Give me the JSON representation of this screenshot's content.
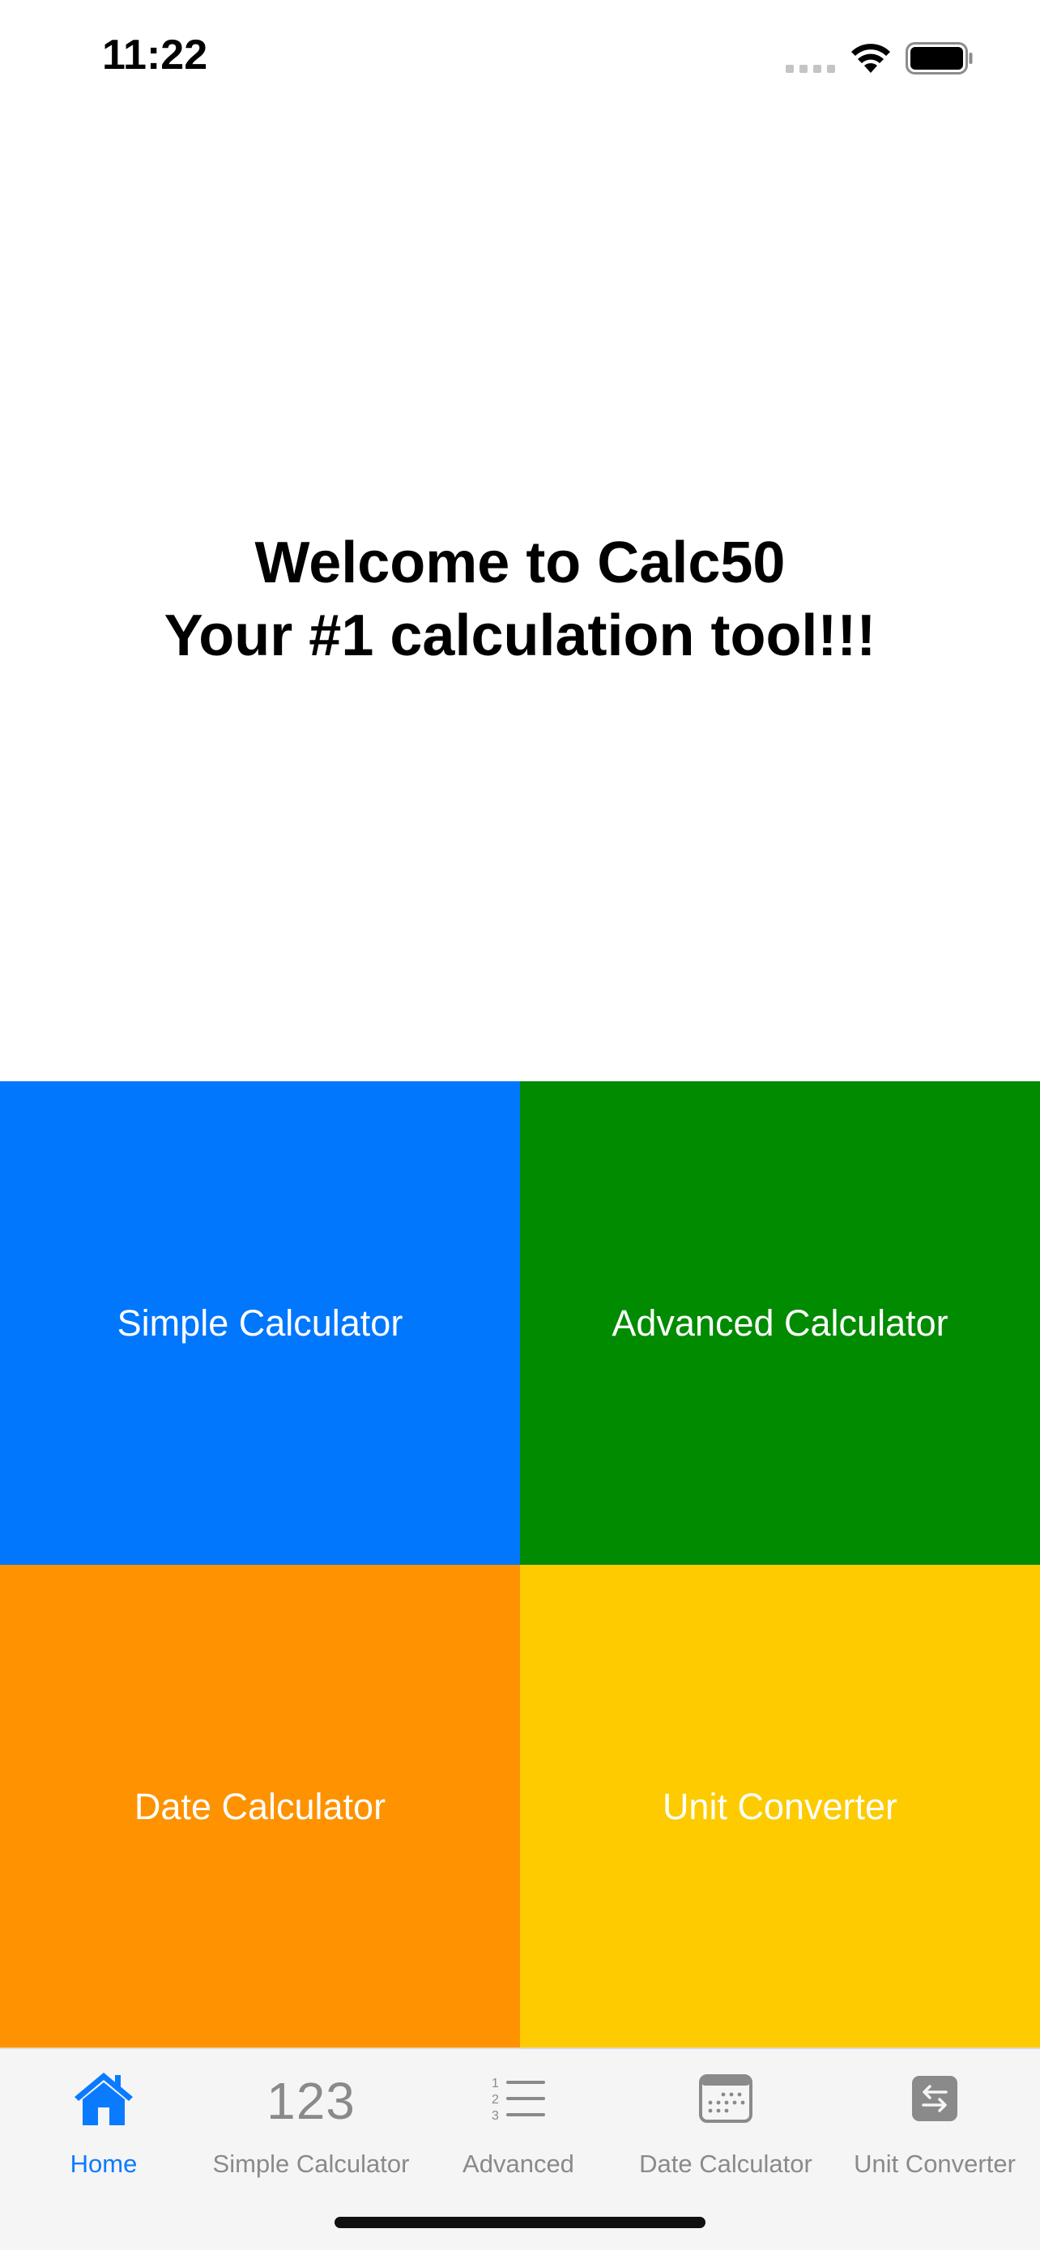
{
  "status_bar": {
    "time": "11:22"
  },
  "welcome": {
    "line1": "Welcome to Calc50",
    "line2": "Your #1 calculation tool!!!"
  },
  "tiles": [
    {
      "label": "Simple Calculator",
      "color": "#0077fd"
    },
    {
      "label": "Advanced Calculator",
      "color": "#008b00"
    },
    {
      "label": "Date Calculator",
      "color": "#fe9200"
    },
    {
      "label": "Unit Converter",
      "color": "#fdcb00"
    }
  ],
  "tab_bar": {
    "active_color": "#0a7bff",
    "inactive_color": "#8a8a8a",
    "tabs": [
      {
        "label": "Home",
        "icon": "house-icon",
        "active": true
      },
      {
        "label": "Simple Calculator",
        "icon": "123-icon",
        "icon_text": "123",
        "active": false
      },
      {
        "label": "Advanced",
        "icon": "numbered-list-icon",
        "active": false
      },
      {
        "label": "Date Calculator",
        "icon": "calendar-icon",
        "active": false
      },
      {
        "label": "Unit Converter",
        "icon": "arrows-exchange-icon",
        "active": false
      }
    ]
  }
}
